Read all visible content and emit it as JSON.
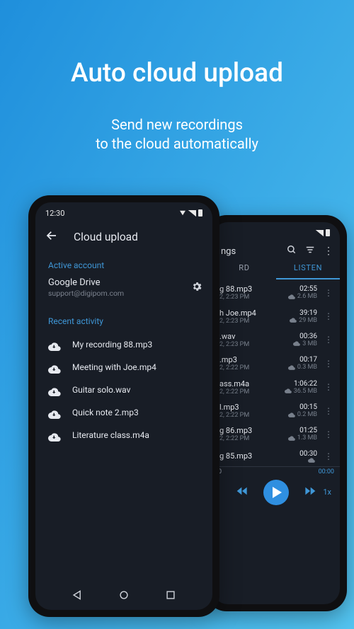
{
  "hero": {
    "title": "Auto cloud upload",
    "subtitle_l1": "Send new recordings",
    "subtitle_l2": "to the cloud automatically"
  },
  "front": {
    "status_time": "12:30",
    "title": "Cloud upload",
    "active_account_heading": "Active account",
    "account_name": "Google Drive",
    "account_email": "support@digipom.com",
    "recent_heading": "Recent activity",
    "recent": [
      "My recording 88.mp3",
      "Meeting with Joe.mp4",
      "Guitar solo.wav",
      "Quick note 2.mp3",
      "Literature class.m4a"
    ]
  },
  "back": {
    "header_title": "ngs",
    "tab_record": "RD",
    "tab_listen": "LISTEN",
    "rows": [
      {
        "name": "g 88.mp3",
        "date": "2, 2:23 PM",
        "dur": "02:55",
        "size": "2.6 MB"
      },
      {
        "name": "h Joe.mp4",
        "date": "2, 2:23 PM",
        "dur": "39:19",
        "size": "29 MB"
      },
      {
        "name": ".wav",
        "date": "2, 2:23 PM",
        "dur": "00:36",
        "size": "3 MB"
      },
      {
        "name": ".mp3",
        "date": "2, 2:22 PM",
        "dur": "00:17",
        "size": "0.3 MB"
      },
      {
        "name": "ass.m4a",
        "date": "2, 2:22 PM",
        "dur": "1:06:22",
        "size": "36.5 MB"
      },
      {
        "name": "l.mp3",
        "date": "2, 2:22 PM",
        "dur": "00:15",
        "size": "0.2 MB"
      },
      {
        "name": "g 86.mp3",
        "date": "2, 2:22 PM",
        "dur": "01:25",
        "size": "1.3 MB"
      },
      {
        "name": "g 85.mp3",
        "date": "",
        "dur": "00:30",
        "size": ""
      }
    ],
    "player": {
      "time_l": "0",
      "time_r": "00:00",
      "speed": "1x"
    }
  }
}
